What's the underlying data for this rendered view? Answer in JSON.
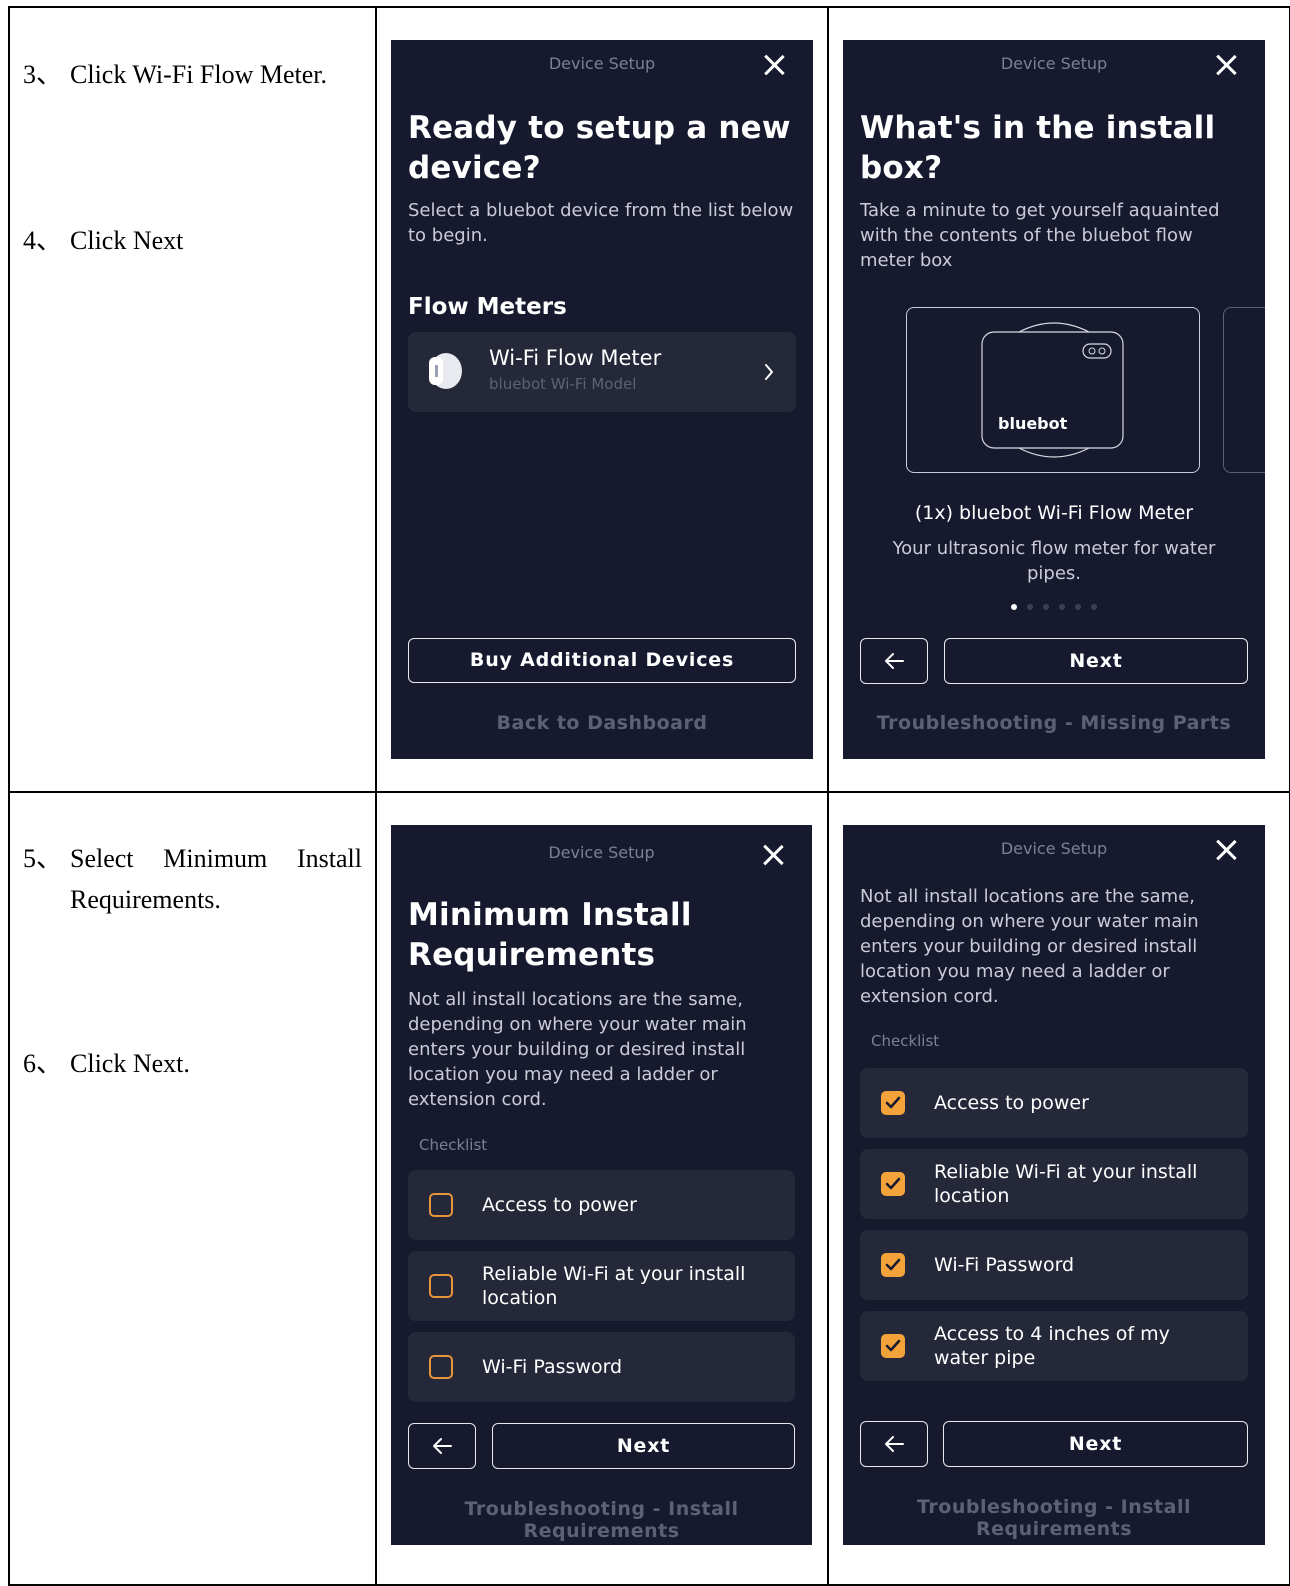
{
  "steps": {
    "s3": {
      "num": "3、",
      "text": "Click Wi-Fi Flow Meter."
    },
    "s4": {
      "num": "4、",
      "text": "Click Next"
    },
    "s5": {
      "num": "5、",
      "text_line1": "Select Minimum Install",
      "text_line2": "Requirements."
    },
    "s6": {
      "num": "6、",
      "text": "Click Next."
    }
  },
  "screen1": {
    "top_title": "Device Setup",
    "heading": "Ready to setup a new device?",
    "subtitle": "Select a bluebot device from the list below to begin.",
    "section": "Flow Meters",
    "device_name": "Wi-Fi Flow Meter",
    "device_model": "bluebot Wi-Fi Model",
    "buy_button": "Buy Additional Devices",
    "back_link": "Back to Dashboard"
  },
  "screen2": {
    "top_title": "Device Setup",
    "heading": "What's in the install box?",
    "subtitle": "Take a minute to get yourself aquainted with the contents of the bluebot flow meter box",
    "brand": "bluebot",
    "item_title": "(1x) bluebot Wi-Fi Flow Meter",
    "item_desc": "Your ultrasonic flow meter for water pipes.",
    "carousel_page": 1,
    "carousel_total": 6,
    "next_button": "Next",
    "footer_link": "Troubleshooting - Missing Parts"
  },
  "screen3": {
    "top_title": "Device Setup",
    "heading": "Minimum Install Requirements",
    "subtitle": "Not all install locations are the same, depending on where your water main enters your building or desired install location you may need a ladder or extension cord.",
    "checklist_label": "Checklist",
    "items": [
      {
        "label": "Access to power",
        "checked": false
      },
      {
        "label": "Reliable Wi-Fi at your install location",
        "checked": false
      },
      {
        "label": "Wi-Fi Password",
        "checked": false
      }
    ],
    "next_button": "Next",
    "footer_link": "Troubleshooting - Install Requirements"
  },
  "screen4": {
    "top_title": "Device Setup",
    "subtitle": "Not all install locations are the same, depending on where your water main enters your building or desired install location you may need a ladder or extension cord.",
    "checklist_label": "Checklist",
    "items": [
      {
        "label": "Access to power",
        "checked": true
      },
      {
        "label": "Reliable Wi-Fi at your install location",
        "checked": true
      },
      {
        "label": "Wi-Fi Password",
        "checked": true
      },
      {
        "label": "Access to 4 inches of my water pipe",
        "checked": true
      }
    ],
    "next_button": "Next",
    "footer_link": "Troubleshooting - Install Requirements"
  },
  "colors": {
    "screen_bg": "#171a2e",
    "card_bg": "#252839",
    "checkbox_accent": "#f4a33b"
  }
}
